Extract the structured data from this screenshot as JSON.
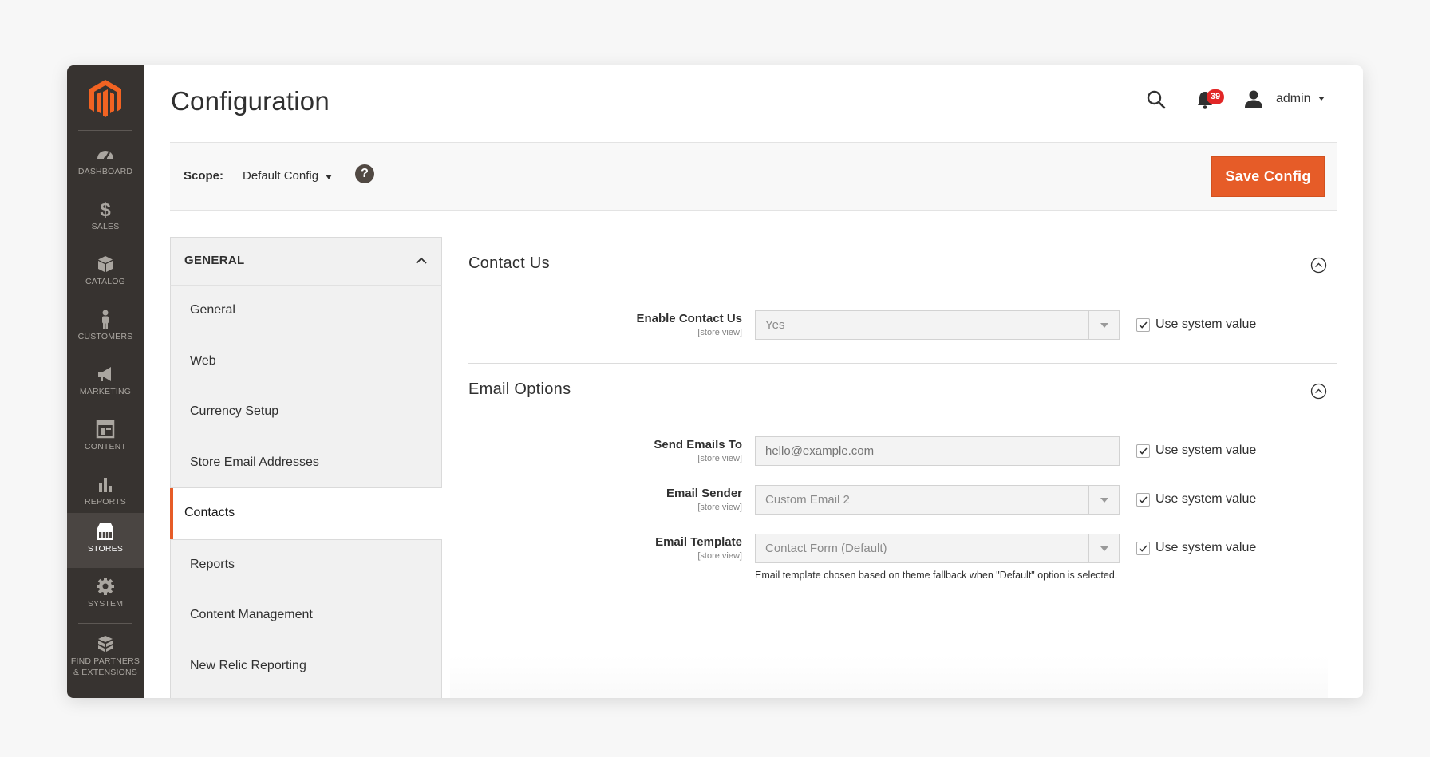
{
  "colors": {
    "accent": "#e65c28",
    "sidebar_bg": "#373330",
    "badge": "#e22626"
  },
  "sidebar": {
    "items": [
      {
        "label": "DASHBOARD",
        "icon": "speedometer-icon",
        "active": false
      },
      {
        "label": "SALES",
        "icon": "dollar-icon",
        "active": false
      },
      {
        "label": "CATALOG",
        "icon": "box-icon",
        "active": false
      },
      {
        "label": "CUSTOMERS",
        "icon": "person-icon",
        "active": false
      },
      {
        "label": "MARKETING",
        "icon": "megaphone-icon",
        "active": false
      },
      {
        "label": "CONTENT",
        "icon": "layout-icon",
        "active": false
      },
      {
        "label": "REPORTS",
        "icon": "bar-chart-icon",
        "active": false
      },
      {
        "label": "STORES",
        "icon": "storefront-icon",
        "active": true
      },
      {
        "label": "SYSTEM",
        "icon": "gear-icon",
        "active": false
      }
    ],
    "partners": {
      "line1": "FIND PARTNERS",
      "line2": "& EXTENSIONS",
      "icon": "blocks-icon"
    }
  },
  "header": {
    "title": "Configuration",
    "notifications_count": "39",
    "user": "admin"
  },
  "scope_bar": {
    "label": "Scope:",
    "value": "Default Config",
    "help": "?",
    "save_button": "Save Config"
  },
  "left_panel": {
    "heading": "GENERAL",
    "items": [
      {
        "label": "General",
        "active": false
      },
      {
        "label": "Web",
        "active": false
      },
      {
        "label": "Currency Setup",
        "active": false
      },
      {
        "label": "Store Email Addresses",
        "active": false
      },
      {
        "label": "Contacts",
        "active": true
      },
      {
        "label": "Reports",
        "active": false
      },
      {
        "label": "Content Management",
        "active": false
      },
      {
        "label": "New Relic Reporting",
        "active": false
      }
    ]
  },
  "sections": {
    "contact_us": {
      "title": "Contact Us",
      "fields": {
        "enable": {
          "label": "Enable Contact Us",
          "scope": "[store view]",
          "value": "Yes",
          "checkbox": "Use system value",
          "checked": true
        }
      }
    },
    "email_options": {
      "title": "Email Options",
      "fields": {
        "send_to": {
          "label": "Send Emails To",
          "scope": "[store view]",
          "placeholder": "hello@example.com",
          "checkbox": "Use system value",
          "checked": true
        },
        "sender": {
          "label": "Email Sender",
          "scope": "[store view]",
          "value": "Custom Email 2",
          "checkbox": "Use system value",
          "checked": true
        },
        "template": {
          "label": "Email Template",
          "scope": "[store view]",
          "value": "Contact Form (Default)",
          "checkbox": "Use system value",
          "checked": true,
          "note": "Email template chosen based on theme fallback when \"Default\" option is selected."
        }
      }
    }
  }
}
